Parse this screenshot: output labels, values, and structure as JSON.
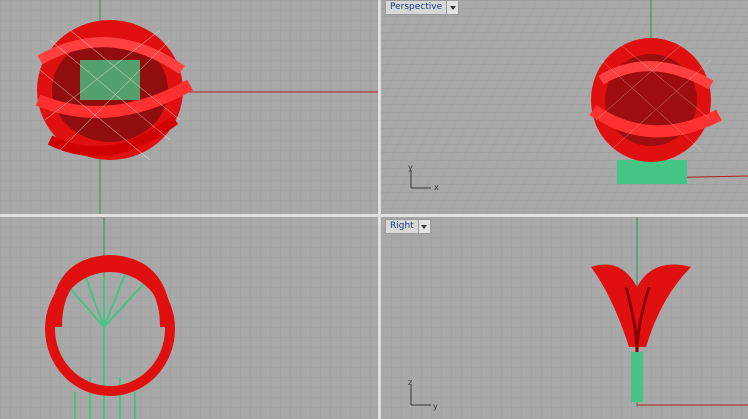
{
  "viewports": {
    "top_left": {
      "label": ""
    },
    "perspective": {
      "label": "Perspective"
    },
    "front": {
      "label": ""
    },
    "right": {
      "label": "Right"
    }
  },
  "axes": {
    "perspective": {
      "a": "y",
      "b": "x"
    },
    "right": {
      "a": "z",
      "b": "y"
    }
  },
  "colors": {
    "background": "#a8a8a8",
    "grid_minor": "#9a9a9a",
    "grid_major": "#8a8a8a",
    "axis_red": "#b02020",
    "axis_green": "#1f9e4a",
    "model_red": "#e01010",
    "support_green": "#46c485",
    "divider": "#e0e0e0"
  },
  "icons": [
    "dropdown-icon"
  ]
}
